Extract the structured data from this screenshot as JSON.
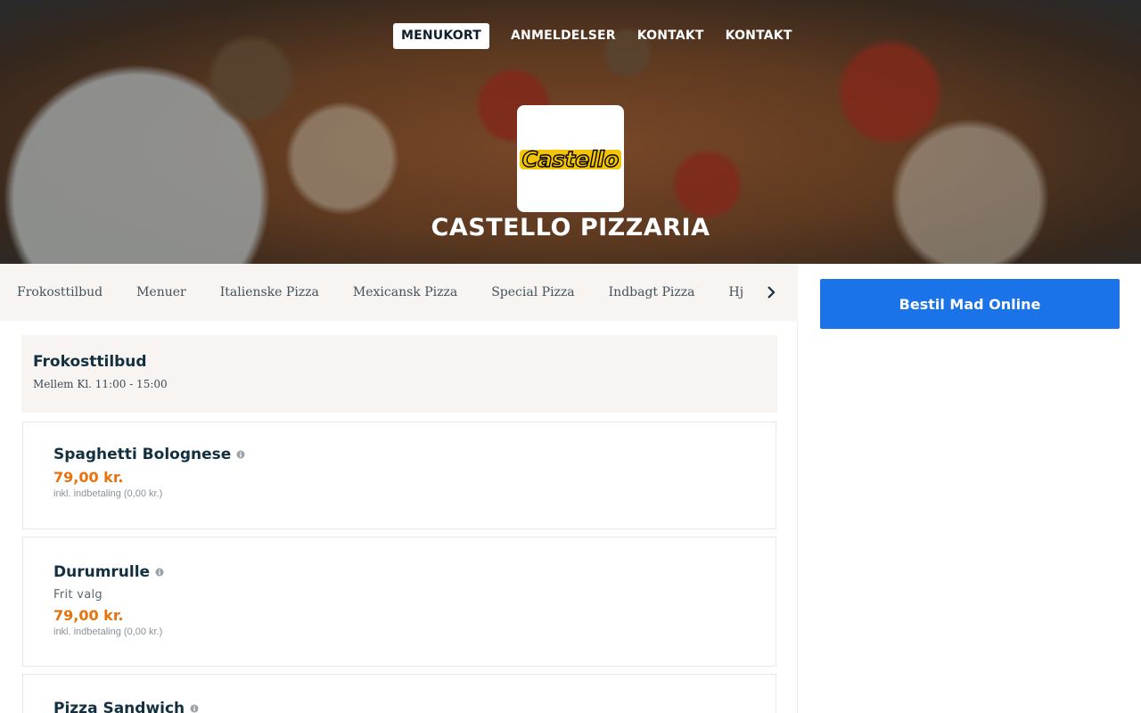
{
  "nav": {
    "items": [
      {
        "label": "MENUKORT",
        "active": true
      },
      {
        "label": "ANMELDELSER",
        "active": false
      },
      {
        "label": "KONTAKT",
        "active": false
      },
      {
        "label": "KONTAKT",
        "active": false
      }
    ]
  },
  "hero": {
    "logo_text": "Castello",
    "restaurant_name": "CASTELLO PIZZARIA"
  },
  "categories": {
    "items": [
      "Frokosttilbud",
      "Menuer",
      "Italienske Pizza",
      "Mexicansk Pizza",
      "Special Pizza",
      "Indbagt Pizza",
      "Hjemmelavede"
    ],
    "arrow_icon": "chevron-right-icon"
  },
  "section": {
    "title": "Frokosttilbud",
    "subtitle": "Mellem Kl. 11:00 - 15:00"
  },
  "menu_items": [
    {
      "name": "Spaghetti Bolognese",
      "description": "",
      "price": "79,00 kr.",
      "note": "inkl. indbetaling (0,00 kr.)"
    },
    {
      "name": "Durumrulle",
      "description": "Frit valg",
      "price": "79,00 kr.",
      "note": "inkl. indbetaling (0,00 kr.)"
    },
    {
      "name": "Pizza Sandwich",
      "description": "",
      "price": "",
      "note": ""
    }
  ],
  "order": {
    "button_label": "Bestil Mad Online"
  },
  "colors": {
    "price": "#e8720c",
    "order_button": "#1a73e8",
    "heading": "#12303f",
    "section_bg": "#f7f4f1"
  }
}
